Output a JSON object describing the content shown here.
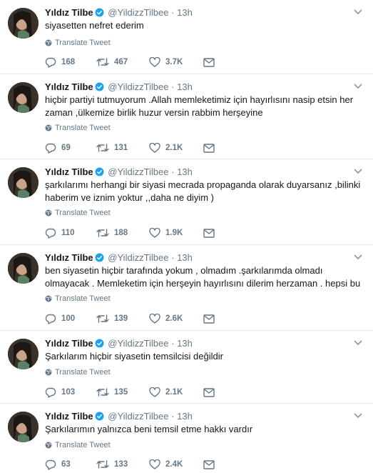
{
  "colors": {
    "verified": "#1da1f2",
    "muted": "#657786",
    "border": "#e6ecf0"
  },
  "icons": {
    "reply": "reply-icon",
    "retweet": "retweet-icon",
    "like": "like-icon",
    "dm": "direct-message-icon",
    "translate": "globe-icon",
    "menu": "chevron-down-icon",
    "verified": "verified-badge-icon"
  },
  "tweets": [
    {
      "name": "Yıldız Tilbe",
      "handle": "@YildizzTilbee",
      "dot": "·",
      "time": "13h",
      "text": "siyasetten nefret ederim",
      "translate": "Translate Tweet",
      "replies": "168",
      "retweets": "467",
      "likes": "3.7K"
    },
    {
      "name": "Yıldız Tilbe",
      "handle": "@YildizzTilbee",
      "dot": "·",
      "time": "13h",
      "text": "hiçbir partiyi tutmuyorum .Allah memleketimiz için hayırlısını nasip etsin her zaman ,ülkemize birlik huzur versin rabbim herşeyine",
      "translate": "Translate Tweet",
      "replies": "69",
      "retweets": "131",
      "likes": "2.1K"
    },
    {
      "name": "Yıldız Tilbe",
      "handle": "@YildizzTilbee",
      "dot": "·",
      "time": "13h",
      "text": "şarkılarımı herhangi bir siyasi mecrada propaganda olarak duyarsanız ,bilinki haberim ve iznim yoktur ,,daha ne diyim )",
      "translate": "Translate Tweet",
      "replies": "110",
      "retweets": "188",
      "likes": "1.9K"
    },
    {
      "name": "Yıldız Tilbe",
      "handle": "@YildizzTilbee",
      "dot": "·",
      "time": "13h",
      "text": "ben siyasetin hiçbir tarafında yokum , olmadım .şarkılarımda olmadı olmayacak . Memleketim için herşeyin hayırlısını dilerim herzaman . hepsi bu",
      "translate": "Translate Tweet",
      "replies": "100",
      "retweets": "139",
      "likes": "2.6K"
    },
    {
      "name": "Yıldız Tilbe",
      "handle": "@YildizzTilbee",
      "dot": "·",
      "time": "13h",
      "text": "Şarkılarım hiçbir siyasetin temsilcisi değildir",
      "translate": "Translate Tweet",
      "replies": "103",
      "retweets": "135",
      "likes": "2.1K"
    },
    {
      "name": "Yıldız Tilbe",
      "handle": "@YildizzTilbee",
      "dot": "·",
      "time": "13h",
      "text": "Şarkılarımın yalnızca beni temsil etme hakkı vardır",
      "translate": "Translate Tweet",
      "replies": "63",
      "retweets": "133",
      "likes": "2.4K"
    }
  ]
}
